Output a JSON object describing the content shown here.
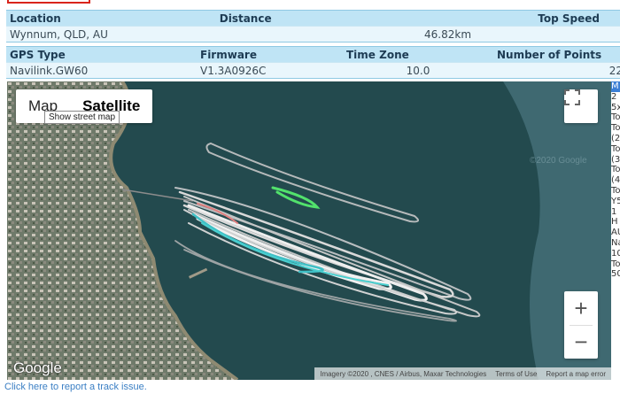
{
  "stats_table_1": {
    "headers": [
      "Location",
      "Distance",
      "Top Speed"
    ],
    "values": [
      "Wynnum, QLD, AU",
      "46.82km",
      ""
    ]
  },
  "stats_table_2": {
    "headers": [
      "GPS Type",
      "Firmware",
      "Time Zone",
      "Number of Points"
    ],
    "values": [
      "Navilink.GW60",
      "V1.3A0926C",
      "10.0",
      "22"
    ]
  },
  "map": {
    "type_map_label": "Map",
    "type_satellite_label": "Satellite",
    "tooltip": "Show street map",
    "zoom_in": "+",
    "zoom_out": "−",
    "logo": "Google",
    "imagery": "Imagery ©2020 , CNES / Airbus, Maxar Technologies",
    "terms": "Terms of Use",
    "report_error": "Report a map error",
    "watermark": "©2020 Google"
  },
  "sidebar_fragments": [
    "M",
    "2",
    "5x",
    "To",
    "To",
    "(2",
    "To",
    "(3",
    "To",
    "(4",
    "To",
    "Y5",
    "1 H",
    "AU",
    "Na",
    "10",
    "To",
    "50"
  ],
  "report_link": "Click here to report a track issue.",
  "colors": {
    "header_bg": "#bfe4f5",
    "value_bg": "#e9f6fc",
    "link": "#3b7fc4",
    "accent": "#d9251c"
  }
}
